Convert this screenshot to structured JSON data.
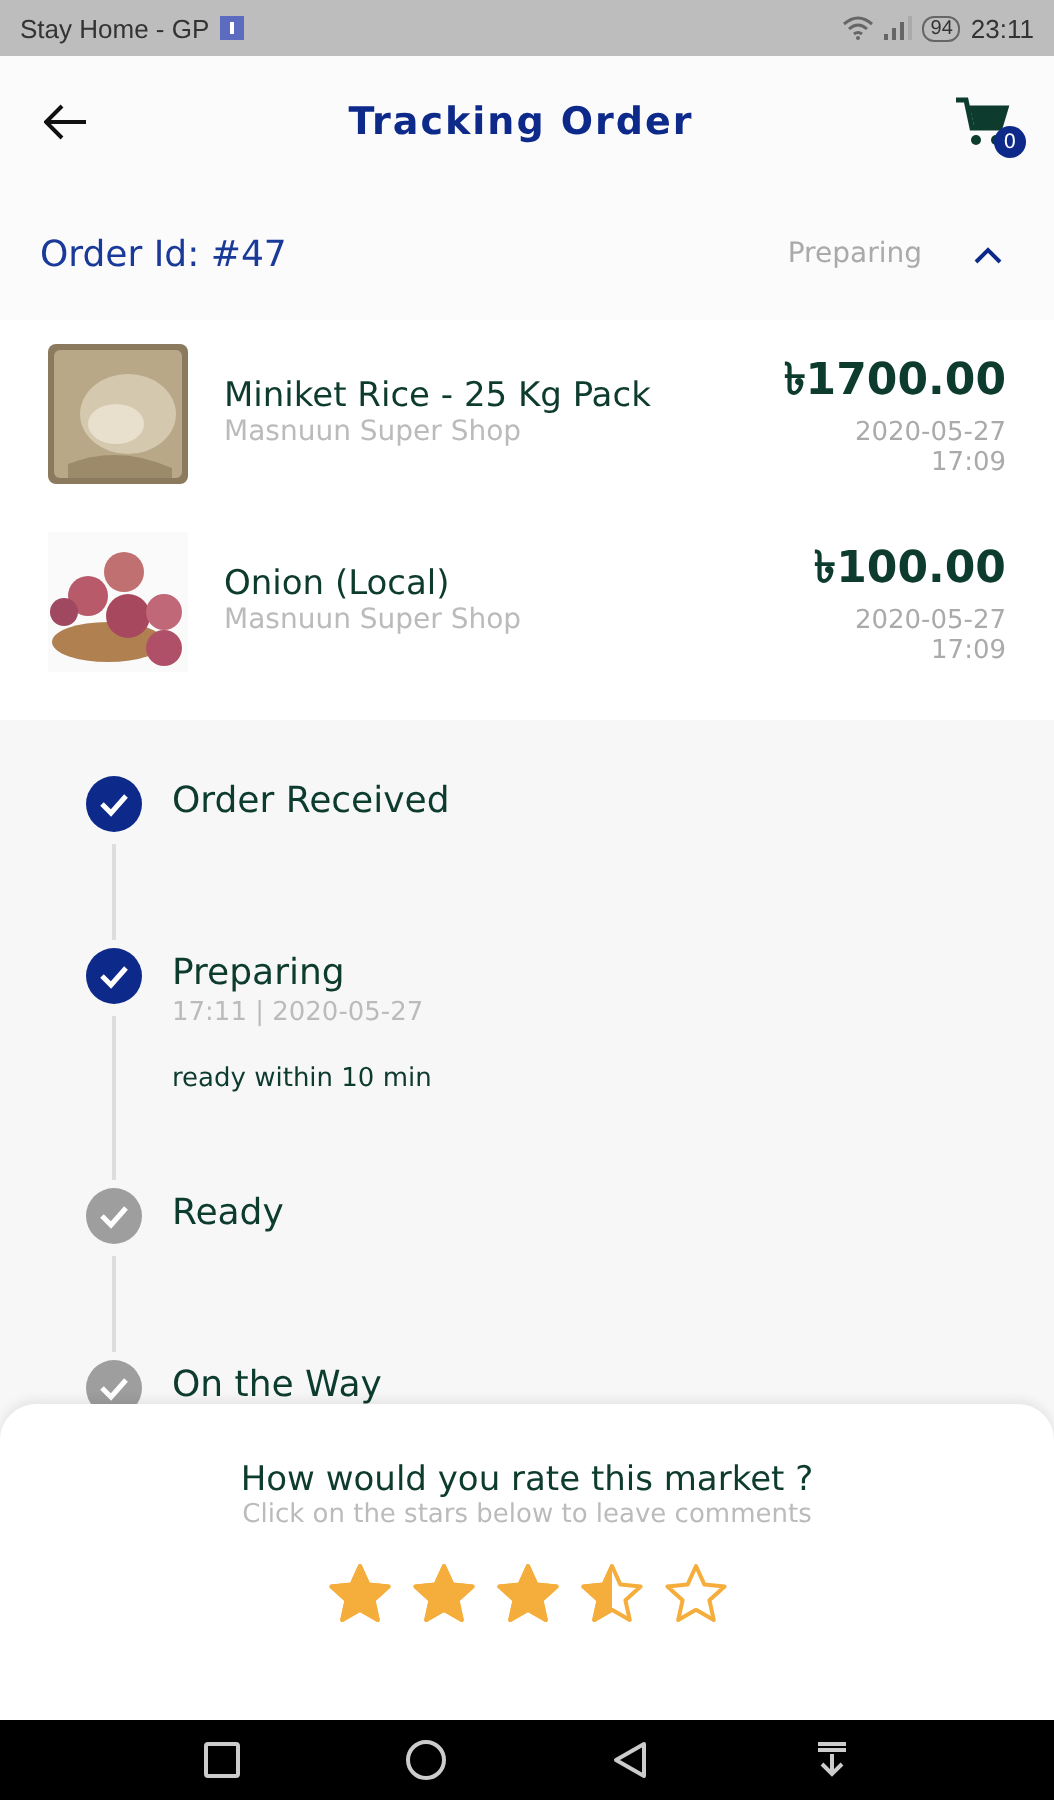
{
  "status_bar": {
    "carrier": "Stay Home - GP",
    "battery": "94",
    "time": "23:11"
  },
  "header": {
    "title": "Tracking Order",
    "cart_count": "0"
  },
  "order": {
    "id": "Order Id: #47",
    "status": "Preparing",
    "expanded": true
  },
  "items": [
    {
      "name": "Miniket Rice - 25 Kg Pack",
      "shop": "Masnuun Super Shop",
      "price": "৳1700.00",
      "date": "2020-05-27",
      "time": "17:09",
      "kind": "rice"
    },
    {
      "name": "Onion (Local)",
      "shop": "Masnuun Super Shop",
      "price": "৳100.00",
      "date": "2020-05-27",
      "time": "17:09",
      "kind": "onion"
    }
  ],
  "steps": [
    {
      "label": "Order Received",
      "done": true
    },
    {
      "label": "Preparing",
      "done": true,
      "time": "17:11 | 2020-05-27",
      "note": "ready within 10 min"
    },
    {
      "label": "Ready",
      "done": false
    },
    {
      "label": "On the Way",
      "done": false
    }
  ],
  "rating": {
    "question": "How would you rate this market ?",
    "hint": "Click on the stars below to leave comments",
    "stars": 3.5
  }
}
